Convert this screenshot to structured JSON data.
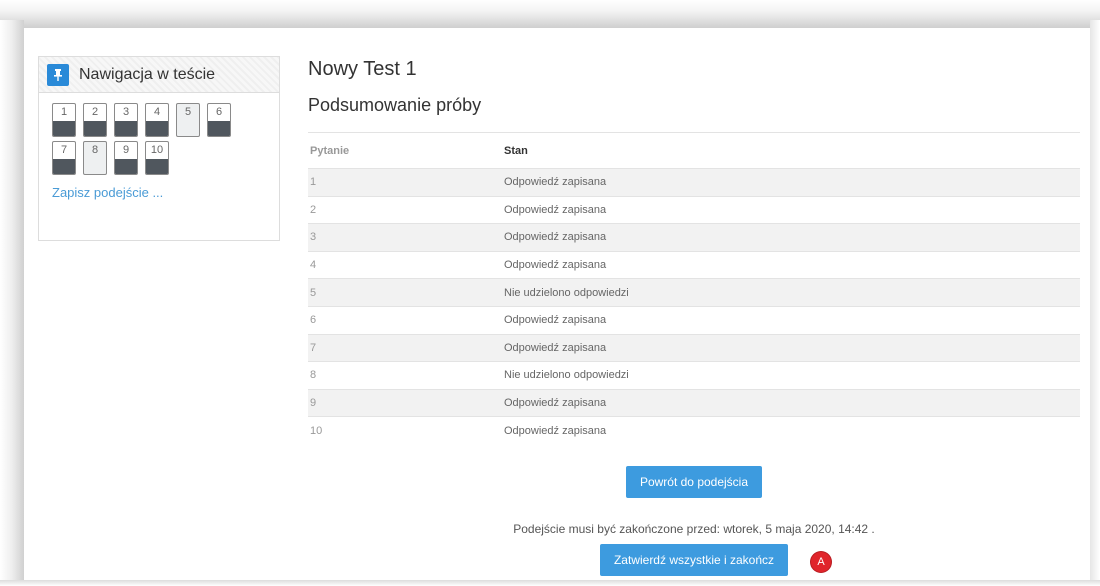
{
  "nav": {
    "title": "Nawigacja w teście",
    "pin_icon": "pin-icon",
    "questions": [
      {
        "num": "1",
        "state": "answered"
      },
      {
        "num": "2",
        "state": "answered"
      },
      {
        "num": "3",
        "state": "answered"
      },
      {
        "num": "4",
        "state": "answered"
      },
      {
        "num": "5",
        "state": "unanswered"
      },
      {
        "num": "6",
        "state": "answered"
      },
      {
        "num": "7",
        "state": "answered"
      },
      {
        "num": "8",
        "state": "unanswered"
      },
      {
        "num": "9",
        "state": "answered"
      },
      {
        "num": "10",
        "state": "answered"
      }
    ],
    "save_link": "Zapisz podejście ..."
  },
  "main": {
    "title": "Nowy Test 1",
    "subtitle": "Podsumowanie próby",
    "table": {
      "headers": [
        "Pytanie",
        "Stan"
      ],
      "rows": [
        [
          "1",
          "Odpowiedź zapisana"
        ],
        [
          "2",
          "Odpowiedź zapisana"
        ],
        [
          "3",
          "Odpowiedź zapisana"
        ],
        [
          "4",
          "Odpowiedź zapisana"
        ],
        [
          "5",
          "Nie udzielono odpowiedzi"
        ],
        [
          "6",
          "Odpowiedź zapisana"
        ],
        [
          "7",
          "Odpowiedź zapisana"
        ],
        [
          "8",
          "Nie udzielono odpowiedzi"
        ],
        [
          "9",
          "Odpowiedź zapisana"
        ],
        [
          "10",
          "Odpowiedź zapisana"
        ]
      ]
    },
    "return_button": "Powrót do podejścia",
    "deadline_text": "Podejście musi być zakończone przed: wtorek, 5 maja 2020, 14:42 .",
    "submit_button": "Zatwierdź wszystkie i zakończ",
    "marker_label": "A"
  },
  "colors": {
    "accent": "#3d9bdf",
    "marker": "#e0252b",
    "answered_bar": "#50575e"
  }
}
